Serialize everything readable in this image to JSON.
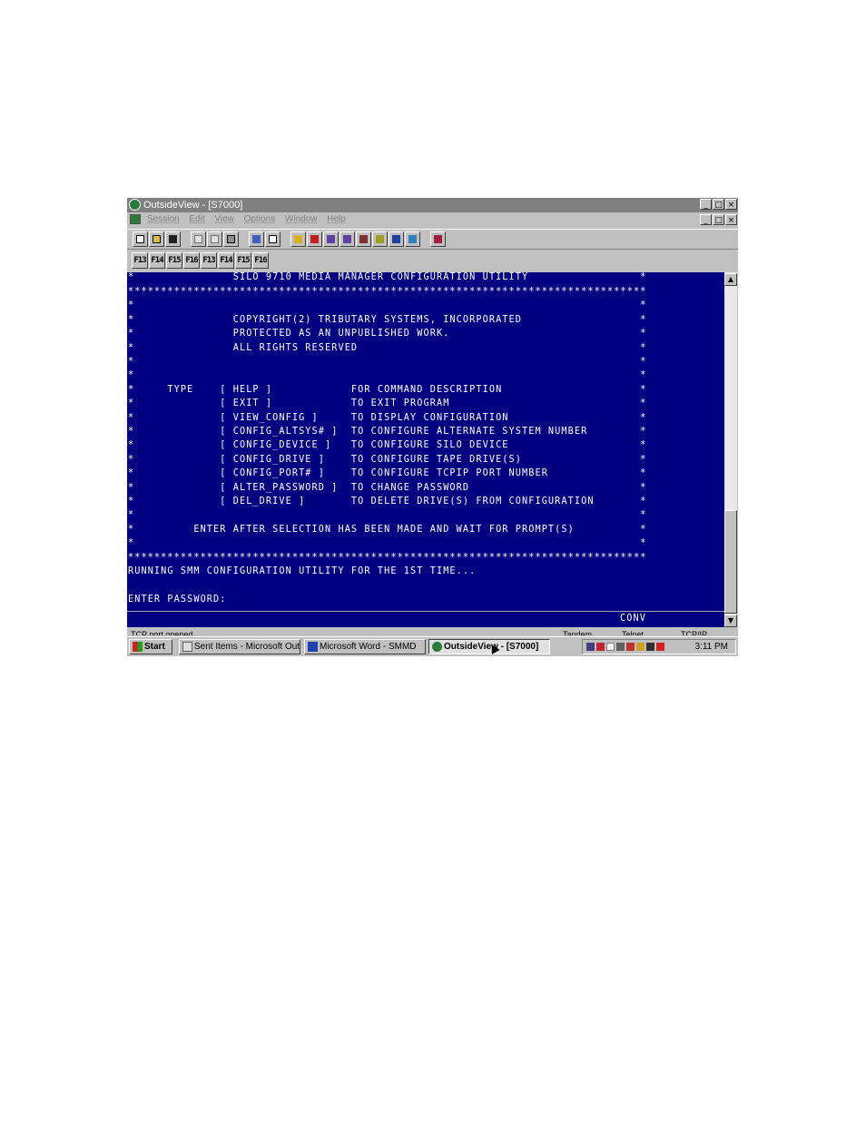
{
  "window": {
    "title": "OutsideView - [S7000]",
    "controls": [
      "_",
      "□",
      "×"
    ],
    "child_controls": [
      "_",
      "□",
      "×"
    ]
  },
  "menu": [
    "Session",
    "Edit",
    "View",
    "Options",
    "Window",
    "Help"
  ],
  "toolbar_icons": [
    "new-icon",
    "open-icon",
    "save-icon",
    "copy-icon",
    "paste-icon",
    "print-icon",
    "properties-icon",
    "settings-icon",
    "connect-icon",
    "disconnect-icon",
    "send-icon",
    "receive-icon",
    "transfer-icon",
    "tools-icon",
    "capture-icon",
    "macro-icon",
    "help-icon"
  ],
  "function_keys": [
    "F13",
    "F14",
    "F15",
    "F16",
    "F13",
    "F14",
    "F15",
    "F16"
  ],
  "terminal": {
    "lines": [
      "*               SILO 9710 MEDIA MANAGER CONFIGURATION UTILITY                 *",
      "*******************************************************************************",
      "*                                                                             *",
      "*               COPYRIGHT(2) TRIBUTARY SYSTEMS, INCORPORATED                  *",
      "*               PROTECTED AS AN UNPUBLISHED WORK.                             *",
      "*               ALL RIGHTS RESERVED                                           *",
      "*                                                                             *",
      "*                                                                             *",
      "*     TYPE    [ HELP ]            FOR COMMAND DESCRIPTION                     *",
      "*             [ EXIT ]            TO EXIT PROGRAM                             *",
      "*             [ VIEW_CONFIG ]     TO DISPLAY CONFIGURATION                    *",
      "*             [ CONFIG_ALTSYS# ]  TO CONFIGURE ALTERNATE SYSTEM NUMBER        *",
      "*             [ CONFIG_DEVICE ]   TO CONFIGURE SILO DEVICE                    *",
      "*             [ CONFIG_DRIVE ]    TO CONFIGURE TAPE DRIVE(S)                  *",
      "*             [ CONFIG_PORT# ]    TO CONFIGURE TCPIP PORT NUMBER              *",
      "*             [ ALTER_PASSWORD ]  TO CHANGE PASSWORD                          *",
      "*             [ DEL_DRIVE ]       TO DELETE DRIVE(S) FROM CONFIGURATION       *",
      "*                                                                             *",
      "*         ENTER AFTER SELECTION HAS BEEN MADE AND WAIT FOR PROMPT(S)          *",
      "*                                                                             *",
      "*******************************************************************************",
      "RUNNING SMM CONFIGURATION UTILITY FOR THE 1ST TIME...",
      "",
      "ENTER PASSWORD:"
    ],
    "oia_status": "CONV"
  },
  "scrollbar": {
    "up": "▲",
    "down": "▼"
  },
  "statusbar": {
    "message": "TCP port opened",
    "panel2": "Tandem",
    "panel3": "Telnet",
    "panel4": "TCP/IP"
  },
  "taskbar": {
    "start": "Start",
    "tasks": [
      "Sent Items - Microsoft Out...",
      "Microsoft Word - SMMD",
      "OutsideView - [S7000]"
    ],
    "clock": "3:11 PM"
  },
  "colors": {
    "terminal_bg": "#000080",
    "terminal_fg": "#ffffff",
    "chrome": "#c0c0c0",
    "titlebar_inactive": "#808080"
  }
}
